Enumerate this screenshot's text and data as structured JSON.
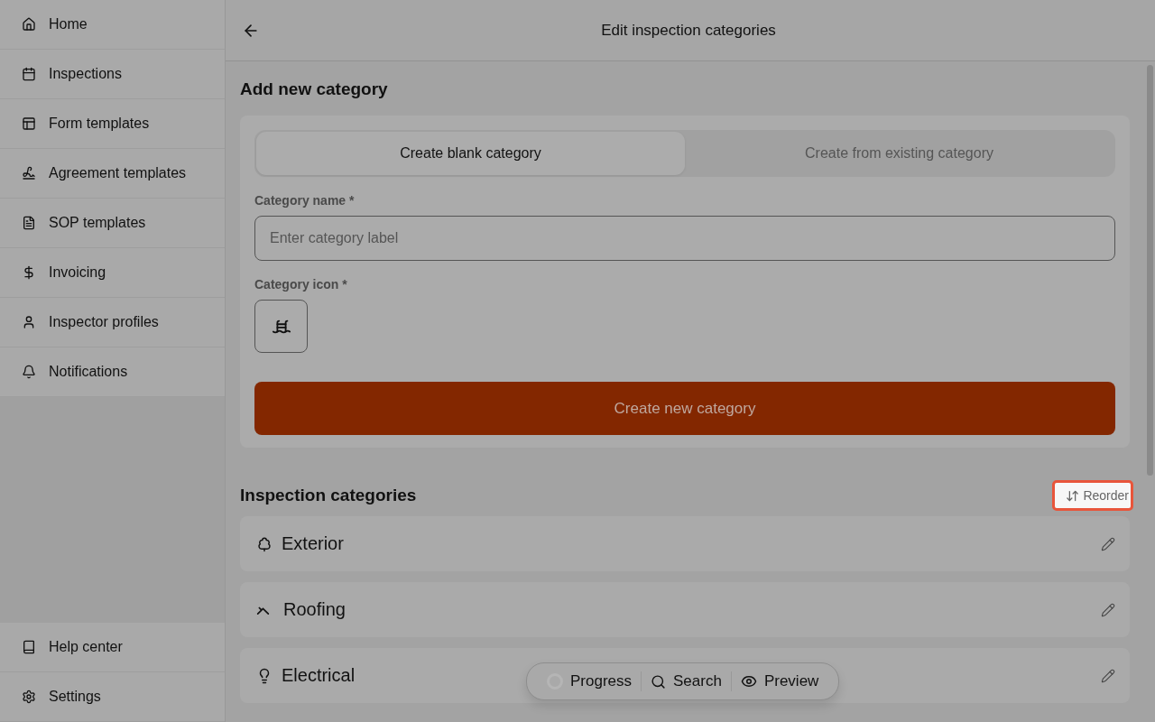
{
  "sidebar": {
    "items": [
      {
        "label": "Home"
      },
      {
        "label": "Inspections"
      },
      {
        "label": "Form templates"
      },
      {
        "label": "Agreement templates"
      },
      {
        "label": "SOP templates"
      },
      {
        "label": "Invoicing"
      },
      {
        "label": "Inspector profiles"
      },
      {
        "label": "Notifications"
      }
    ],
    "footer_items": [
      {
        "label": "Help center"
      },
      {
        "label": "Settings"
      }
    ]
  },
  "header": {
    "title": "Edit inspection categories"
  },
  "add_section": {
    "title": "Add new category",
    "tabs": [
      {
        "label": "Create blank category",
        "selected": true
      },
      {
        "label": "Create from existing category",
        "selected": false
      }
    ],
    "name_label": "Category name *",
    "name_placeholder": "Enter category label",
    "icon_label": "Category icon *",
    "submit": "Create new category"
  },
  "categories": {
    "title": "Inspection categories",
    "reorder": "Reorder",
    "items": [
      {
        "label": "Exterior"
      },
      {
        "label": "Roofing"
      },
      {
        "label": "Electrical"
      }
    ]
  },
  "toolbar": {
    "items": [
      {
        "label": "Progress"
      },
      {
        "label": "Search"
      },
      {
        "label": "Preview"
      }
    ]
  }
}
